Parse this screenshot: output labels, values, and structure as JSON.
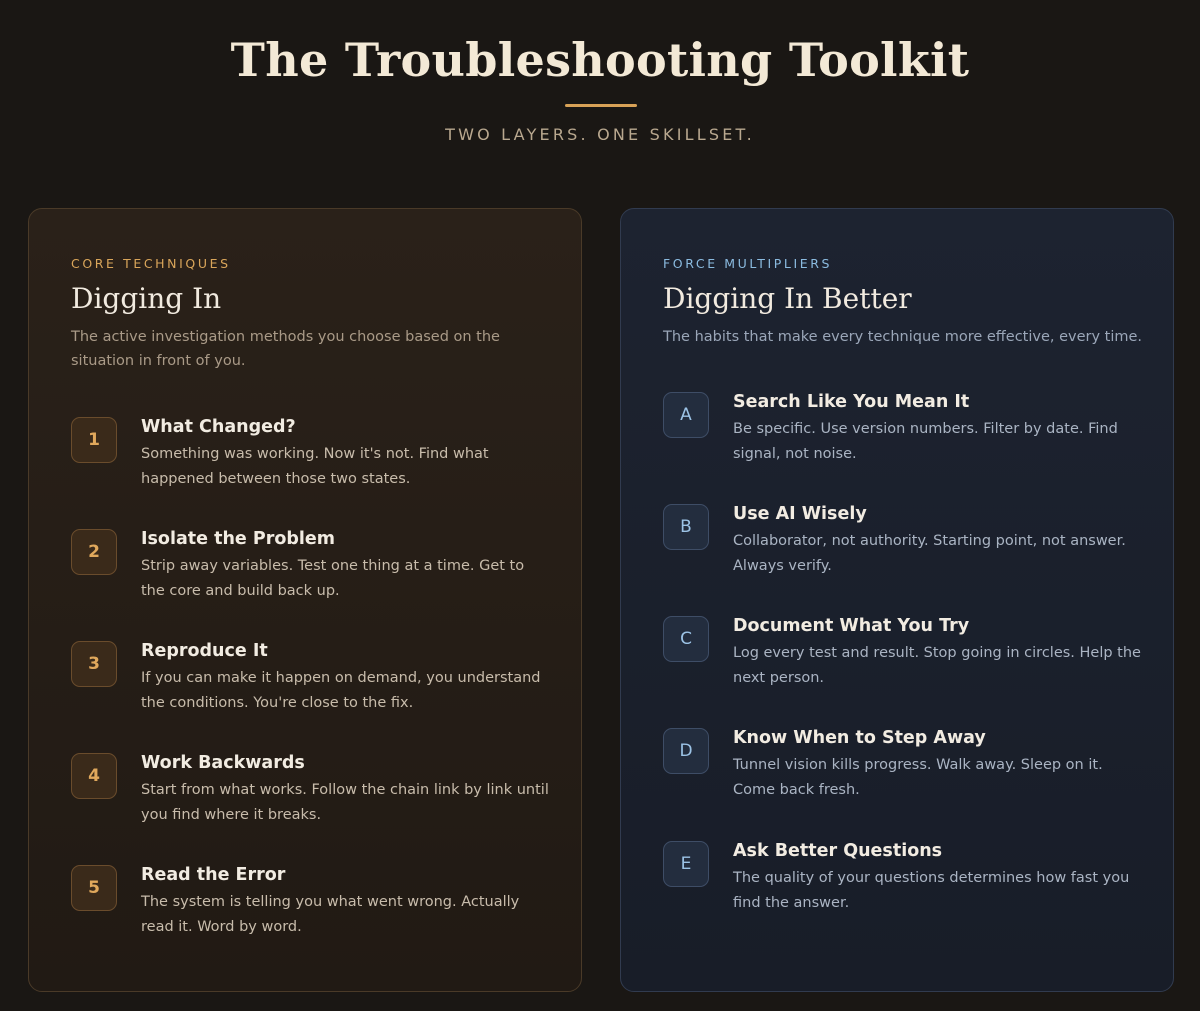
{
  "header": {
    "title": "The Troubleshooting Toolkit",
    "subtitle": "TWO LAYERS. ONE SKILLSET."
  },
  "colors": {
    "background": "#1a1714",
    "accent_gold": "#d8a257",
    "accent_blue": "#8bbbe0"
  },
  "core": {
    "eyebrow": "CORE TECHNIQUES",
    "title": "Digging In",
    "description": "The active investigation methods you choose based on the situation in front of you.",
    "items": [
      {
        "badge": "1",
        "title": "What Changed?",
        "description": "Something was working. Now it's not. Find what happened between those two states."
      },
      {
        "badge": "2",
        "title": "Isolate the Problem",
        "description": "Strip away variables. Test one thing at a time. Get to the core and build back up."
      },
      {
        "badge": "3",
        "title": "Reproduce It",
        "description": "If you can make it happen on demand, you understand the conditions. You're close to the fix."
      },
      {
        "badge": "4",
        "title": "Work Backwards",
        "description": "Start from what works. Follow the chain link by link until you find where it breaks."
      },
      {
        "badge": "5",
        "title": "Read the Error",
        "description": "The system is telling you what went wrong. Actually read it. Word by word."
      }
    ]
  },
  "multipliers": {
    "eyebrow": "FORCE MULTIPLIERS",
    "title": "Digging In Better",
    "description": "The habits that make every technique more effective, every time.",
    "items": [
      {
        "badge": "A",
        "title": "Search Like You Mean It",
        "description": "Be specific. Use version numbers. Filter by date. Find signal, not noise."
      },
      {
        "badge": "B",
        "title": "Use AI Wisely",
        "description": "Collaborator, not authority. Starting point, not answer. Always verify."
      },
      {
        "badge": "C",
        "title": "Document What You Try",
        "description": "Log every test and result. Stop going in circles. Help the next person."
      },
      {
        "badge": "D",
        "title": "Know When to Step Away",
        "description": "Tunnel vision kills progress. Walk away. Sleep on it. Come back fresh."
      },
      {
        "badge": "E",
        "title": "Ask Better Questions",
        "description": "The quality of your questions determines how fast you find the answer."
      }
    ]
  }
}
